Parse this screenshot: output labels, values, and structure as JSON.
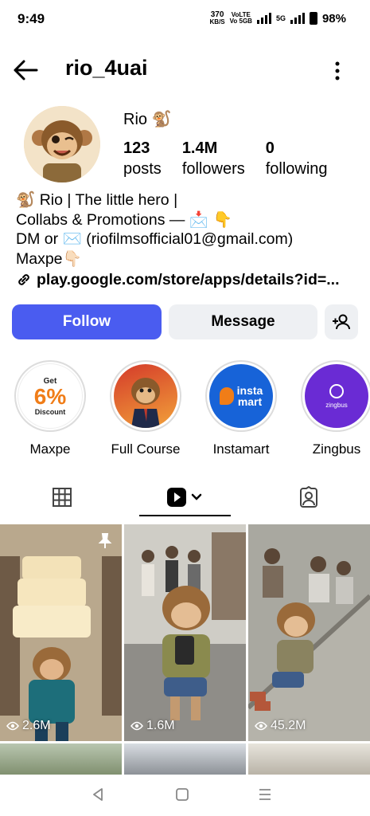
{
  "status_bar": {
    "time": "9:49",
    "speed_value": "370",
    "speed_unit": "KB/S",
    "volte1": "VoLTE",
    "volte2": "Vo 5GB",
    "network": "5G",
    "battery": "98%"
  },
  "header": {
    "username": "rio_4uai"
  },
  "profile": {
    "display_name": "Rio 🐒",
    "stats": [
      {
        "value": "123",
        "label": "posts"
      },
      {
        "value": "1.4M",
        "label": "followers"
      },
      {
        "value": "0",
        "label": "following"
      }
    ],
    "bio_lines": [
      "🐒 Rio | The little hero |",
      "Collabs & Promotions — 📩 👇",
      "DM or ✉️ (riofilmsofficial01@gmail.com)",
      "Maxpe👇🏻"
    ],
    "link": "play.google.com/store/apps/details?id=..."
  },
  "actions": {
    "follow": "Follow",
    "message": "Message"
  },
  "highlights": [
    {
      "label": "Maxpe",
      "badge_top": "Get",
      "badge_main": "6%",
      "badge_bottom": "Discount"
    },
    {
      "label": "Full Course"
    },
    {
      "label": "Instamart",
      "badge_main": "insta\nmart"
    },
    {
      "label": "Zingbus",
      "badge_main": "zingbus"
    }
  ],
  "posts": [
    {
      "views": "2.6M",
      "pinned": true
    },
    {
      "views": "1.6M"
    },
    {
      "views": "45.2M"
    }
  ],
  "colors": {
    "follow_bg": "#4a5cf0",
    "message_bg": "#eef0f3",
    "instamart_bg": "#1763d8",
    "zingbus_bg": "#6a2bd4",
    "maxpe_orange": "#f07d18"
  }
}
